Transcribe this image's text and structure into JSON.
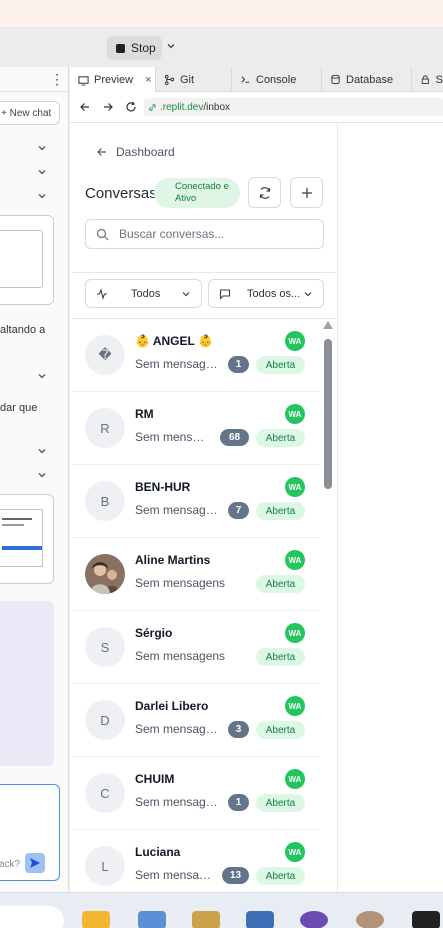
{
  "toolbar": {
    "stop_label": "Stop"
  },
  "left_panel": {
    "new_chat_label": "+ New chat",
    "text1": "altando a",
    "text2": "dar que",
    "input_placeholder": "ack?"
  },
  "tabs": [
    {
      "label": "Preview",
      "icon": "monitor-icon"
    },
    {
      "label": "Git",
      "icon": "git-icon"
    },
    {
      "label": "Console",
      "icon": "terminal-icon"
    },
    {
      "label": "Database",
      "icon": "database-icon"
    },
    {
      "label": "S",
      "icon": "lock-icon"
    }
  ],
  "url": {
    "domain": ".replit.dev",
    "path": "/inbox"
  },
  "app": {
    "back_label": "Dashboard",
    "title": "Conversas",
    "status": "Conectado e Ativo",
    "search_placeholder": "Buscar conversas...",
    "filter1": "Todos",
    "filter2": "Todos os...",
    "channel_badge": "WA"
  },
  "conversations": [
    {
      "name": "👶 ANGEL 👶",
      "avatar": "�",
      "preview": "Sem mensagens",
      "count": "1",
      "status": "Aberta"
    },
    {
      "name": "RM",
      "avatar": "R",
      "preview": "Sem mensag...",
      "count": "68",
      "status": "Aberta"
    },
    {
      "name": "BEN-HUR",
      "avatar": "B",
      "preview": "Sem mensage...",
      "count": "7",
      "status": "Aberta"
    },
    {
      "name": "Aline Martins",
      "avatar": "",
      "preview": "Sem mensagens",
      "count": "",
      "status": "Aberta"
    },
    {
      "name": "Sérgio",
      "avatar": "S",
      "preview": "Sem mensagens",
      "count": "",
      "status": "Aberta"
    },
    {
      "name": "Darlei Libero",
      "avatar": "D",
      "preview": "Sem mensage...",
      "count": "3",
      "status": "Aberta"
    },
    {
      "name": "CHUIM",
      "avatar": "C",
      "preview": "Sem mensagens",
      "count": "1",
      "status": "Aberta"
    },
    {
      "name": "Luciana",
      "avatar": "L",
      "preview": "Sem mensag...",
      "count": "13",
      "status": "Aberta"
    }
  ],
  "colors": {
    "accent_green": "#22c55e",
    "badge_gray": "#64748b",
    "status_bg": "#dcf7e6"
  }
}
